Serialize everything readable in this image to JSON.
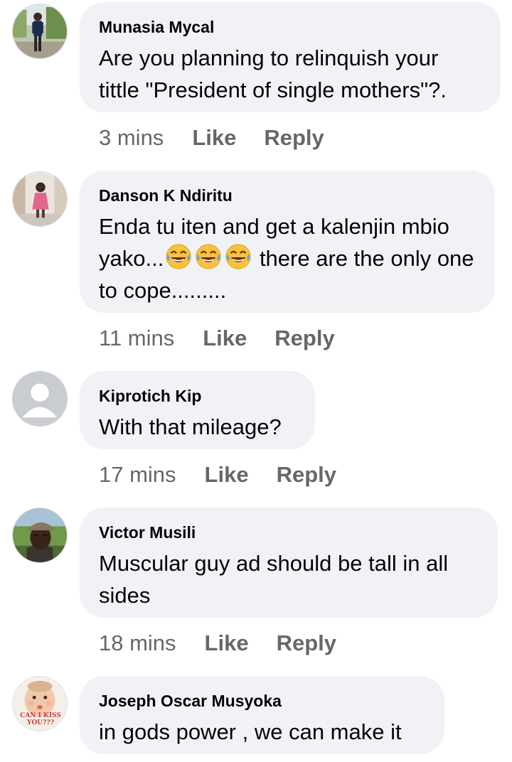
{
  "comments": [
    {
      "author": "Munasia Mycal",
      "text": "Are you planning to relinquish your tittle \"President of single mothers\"?.",
      "time": "3 mins",
      "avatar_icon": "person-standing-outdoors-avatar"
    },
    {
      "author": "Danson K Ndiritu",
      "text_before": "Enda tu iten and get a kalenjin mbio yako...",
      "emojis": [
        "face-with-tears-of-joy",
        "face-with-tears-of-joy",
        "face-with-tears-of-joy"
      ],
      "text_after": " there are the only one to cope.........",
      "time": "11 mins",
      "avatar_icon": "child-in-pink-avatar"
    },
    {
      "author": "Kiprotich Kip",
      "text": "With that mileage?",
      "time": "17 mins",
      "avatar_icon": "default-profile-avatar"
    },
    {
      "author": "Victor Musili",
      "text": "Muscular guy ad should be tall in all sides",
      "time": "18 mins",
      "avatar_icon": "man-with-cap-avatar"
    },
    {
      "author": "Joseph Oscar Musyoka",
      "text": "in gods power , we can make it",
      "time": "",
      "avatar_icon": "baby-face-avatar",
      "avatar_text": "CAN I KISS YOU???"
    }
  ],
  "actions": {
    "like_label": "Like",
    "reply_label": "Reply"
  },
  "colors": {
    "bubble_bg": "#f0f2f5",
    "text": "#050505",
    "meta": "#65676b"
  }
}
